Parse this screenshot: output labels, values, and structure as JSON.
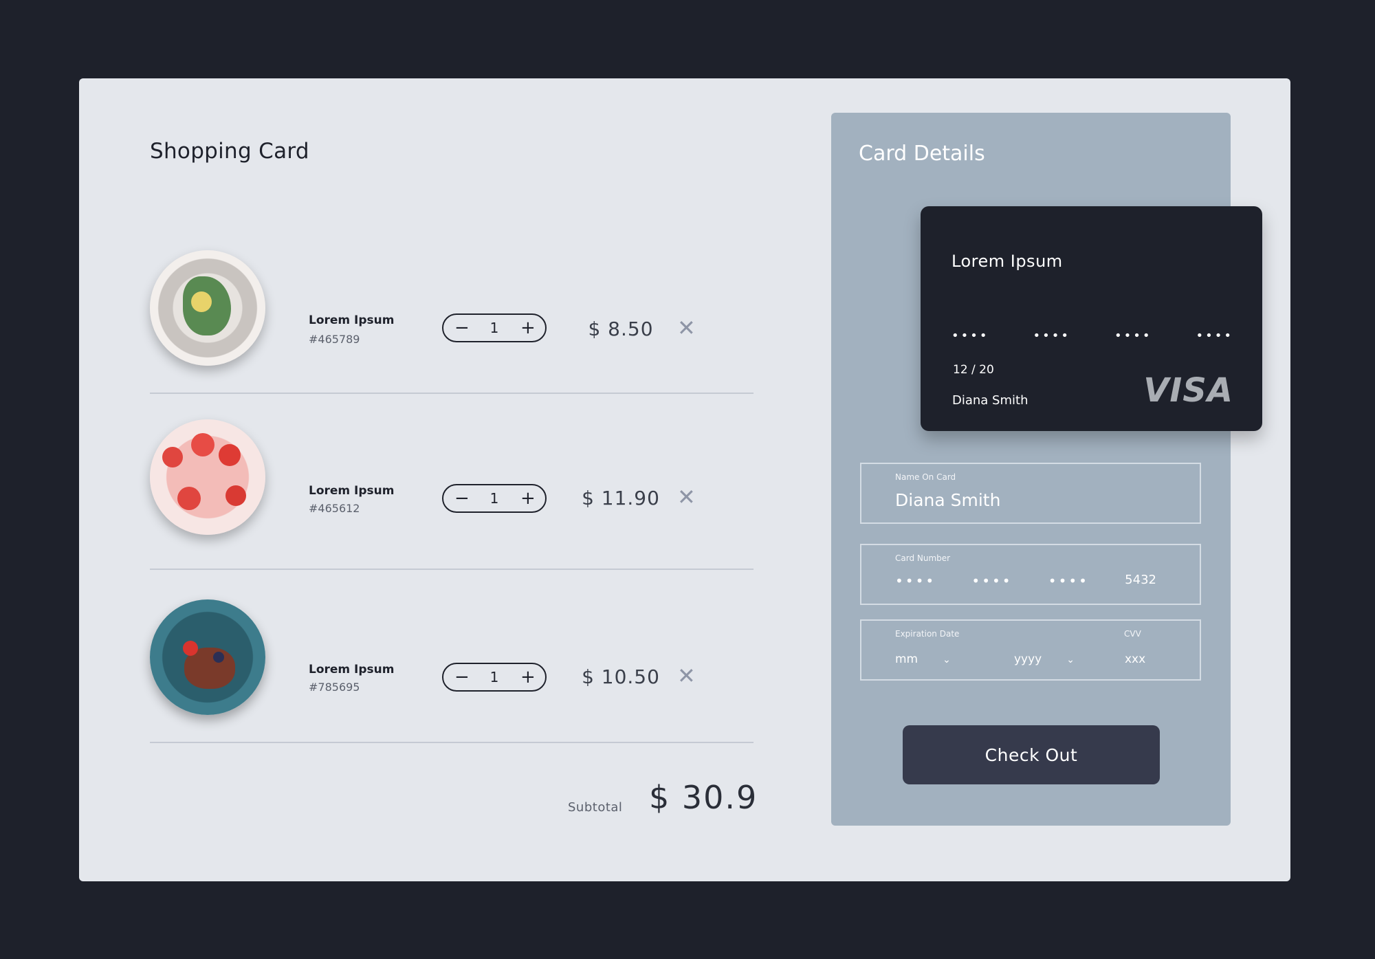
{
  "cart": {
    "title": "Shopping Card",
    "items": [
      {
        "name": "Lorem Ipsum",
        "sku": "#465789",
        "qty": "1",
        "price": "$ 8.50",
        "minus": "−",
        "plus": "+",
        "remove": "✕"
      },
      {
        "name": "Lorem Ipsum",
        "sku": "#465612",
        "qty": "1",
        "price": "$ 11.90",
        "minus": "−",
        "plus": "+",
        "remove": "✕"
      },
      {
        "name": "Lorem Ipsum",
        "sku": "#785695",
        "qty": "1",
        "price": "$ 10.50",
        "minus": "−",
        "plus": "+",
        "remove": "✕"
      }
    ],
    "subtotal_label": "Subtotal",
    "subtotal_value": "$ 30.9"
  },
  "card_details": {
    "title": "Card Details",
    "card": {
      "name": "Lorem Ipsum",
      "groups": [
        "••••",
        "••••",
        "••••",
        "••••"
      ],
      "expiry": "12 / 20",
      "holder": "Diana Smith",
      "brand": "VISA"
    },
    "name_field": {
      "label": "Name On Card",
      "value": "Diana Smith"
    },
    "number_field": {
      "label": "Card Number",
      "groups": [
        "••••",
        "••••",
        "••••",
        "5432"
      ]
    },
    "expiry_field": {
      "label": "Expiration Date",
      "month": "mm",
      "year": "yyyy",
      "cvv_label": "CVV",
      "cvv": "xxx",
      "chevron": "⌄"
    },
    "checkout_label": "Check Out"
  },
  "colors": {
    "background": "#1e212b",
    "panel": "#e4e7ec",
    "card_panel": "#a2b1bf",
    "credit_card": "#1e212b",
    "checkout_button": "#363a4c"
  }
}
